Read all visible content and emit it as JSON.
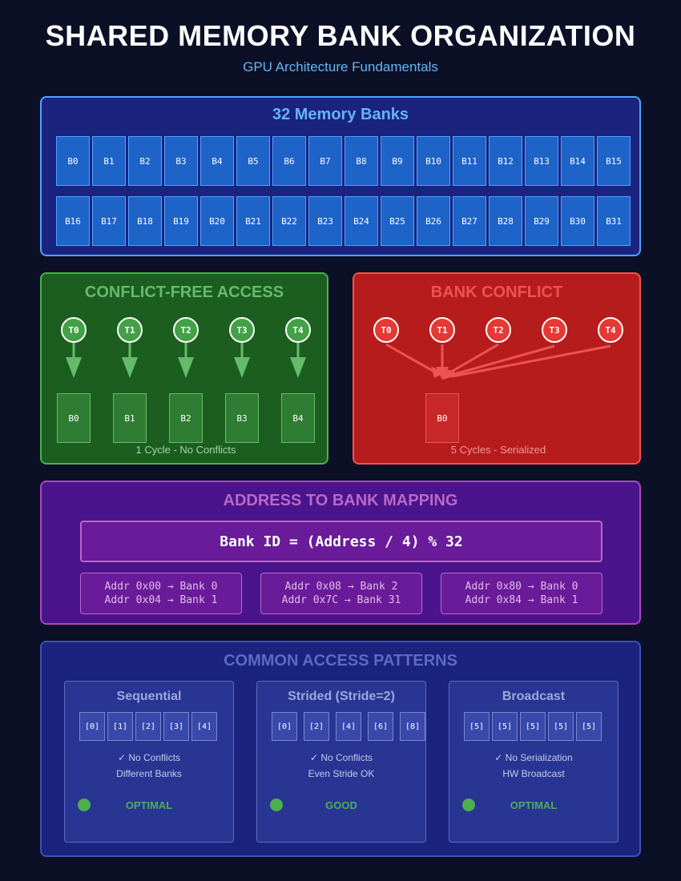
{
  "header": {
    "title": "SHARED MEMORY BANK ORGANIZATION",
    "subtitle": "GPU Architecture Fundamentals"
  },
  "banks_panel": {
    "title": "32 Memory Banks",
    "banks": [
      "B0",
      "B1",
      "B2",
      "B3",
      "B4",
      "B5",
      "B6",
      "B7",
      "B8",
      "B9",
      "B10",
      "B11",
      "B12",
      "B13",
      "B14",
      "B15",
      "B16",
      "B17",
      "B18",
      "B19",
      "B20",
      "B21",
      "B22",
      "B23",
      "B24",
      "B25",
      "B26",
      "B27",
      "B28",
      "B29",
      "B30",
      "B31"
    ]
  },
  "conflict_free": {
    "title": "CONFLICT-FREE ACCESS",
    "threads": [
      "T0",
      "T1",
      "T2",
      "T3",
      "T4"
    ],
    "banks": [
      "B0",
      "B1",
      "B2",
      "B3",
      "B4"
    ],
    "caption": "1 Cycle - No Conflicts"
  },
  "bank_conflict": {
    "title": "BANK CONFLICT",
    "threads": [
      "T0",
      "T1",
      "T2",
      "T3",
      "T4"
    ],
    "bank": "B0",
    "caption": "5 Cycles - Serialized"
  },
  "mapping": {
    "title": "ADDRESS TO BANK MAPPING",
    "formula": "Bank ID = (Address / 4) % 32",
    "examples": [
      [
        "Addr 0x00 → Bank 0",
        "Addr 0x04 → Bank 1"
      ],
      [
        "Addr 0x08 → Bank 2",
        "Addr 0x7C → Bank 31"
      ],
      [
        "Addr 0x80 → Bank 0",
        "Addr 0x84 → Bank 1"
      ]
    ]
  },
  "patterns": {
    "title": "COMMON ACCESS PATTERNS",
    "items": [
      {
        "title": "Sequential",
        "cells": [
          "[0]",
          "[1]",
          "[2]",
          "[3]",
          "[4]"
        ],
        "line1": "✓ No Conflicts",
        "line2": "Different Banks",
        "status": "OPTIMAL"
      },
      {
        "title": "Strided (Stride=2)",
        "cells": [
          "[0]",
          "[2]",
          "[4]",
          "[6]",
          "[8]"
        ],
        "line1": "✓ No Conflicts",
        "line2": "Even Stride OK",
        "status": "GOOD"
      },
      {
        "title": "Broadcast",
        "cells": [
          "[5]",
          "[5]",
          "[5]",
          "[5]",
          "[5]"
        ],
        "line1": "✓ No Serialization",
        "line2": "HW Broadcast",
        "status": "OPTIMAL"
      }
    ]
  },
  "colors": {
    "background": "#0b1026",
    "banks_panel": "#1a237e",
    "green_panel": "#1b5e20",
    "red_panel": "#b71c1c",
    "purple_panel": "#4a148c",
    "status_green": "#4caf50"
  }
}
